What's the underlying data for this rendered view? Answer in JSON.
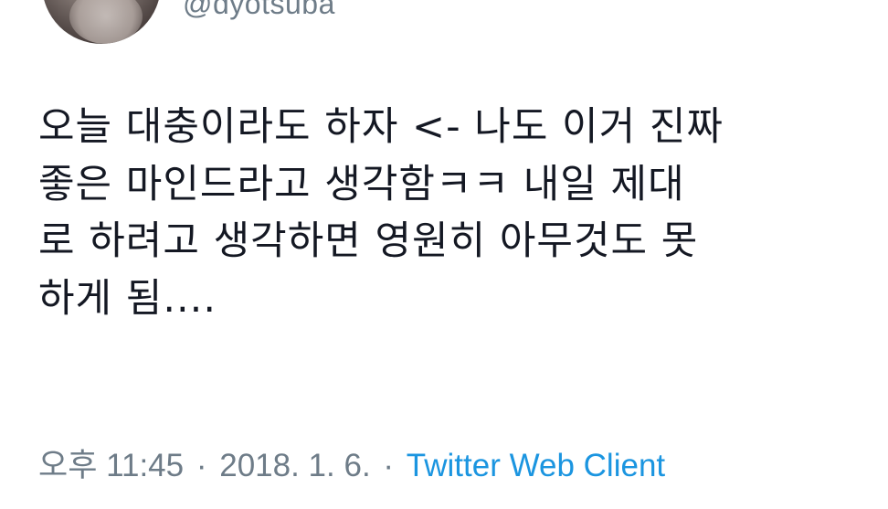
{
  "author": {
    "handle": "@dyotsuba"
  },
  "tweet": {
    "text": "오늘 대충이라도 하자 <- 나도 이거 진짜\n좋은 마인드라고 생각함ㅋㅋ 내일 제대\n로 하려고 생각하면 영원히 아무것도 못\n하게 됨...."
  },
  "meta": {
    "time": "오후 11:45",
    "separator": "·",
    "date": "2018. 1. 6.",
    "source": "Twitter Web Client"
  },
  "colors": {
    "text": "#141823",
    "muted": "#6e7c88",
    "link": "#1b95e0"
  }
}
